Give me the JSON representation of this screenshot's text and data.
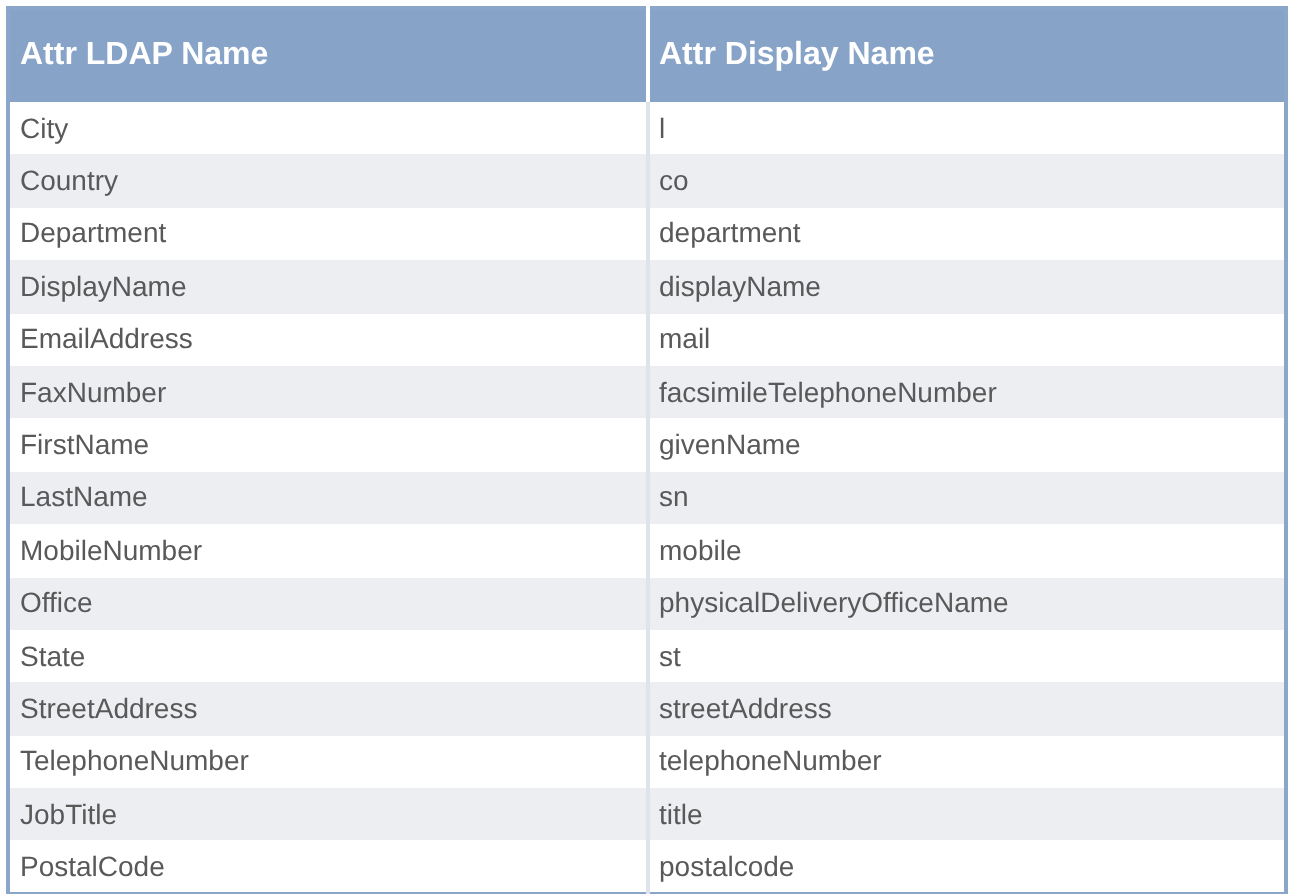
{
  "table": {
    "columns": [
      "Attr LDAP Name",
      "Attr Display Name"
    ],
    "rows": [
      [
        "City",
        "l"
      ],
      [
        "Country",
        "co"
      ],
      [
        "Department",
        "department"
      ],
      [
        "DisplayName",
        "displayName"
      ],
      [
        "EmailAddress",
        "mail"
      ],
      [
        "FaxNumber",
        "facsimileTelephoneNumber"
      ],
      [
        "FirstName",
        "givenName"
      ],
      [
        "LastName",
        "sn"
      ],
      [
        "MobileNumber",
        "mobile"
      ],
      [
        "Office",
        "physicalDeliveryOfficeName"
      ],
      [
        "State",
        "st"
      ],
      [
        "StreetAddress",
        "streetAddress"
      ],
      [
        "TelephoneNumber",
        "telephoneNumber"
      ],
      [
        "JobTitle",
        "title"
      ],
      [
        "PostalCode",
        "postalcode"
      ]
    ]
  }
}
